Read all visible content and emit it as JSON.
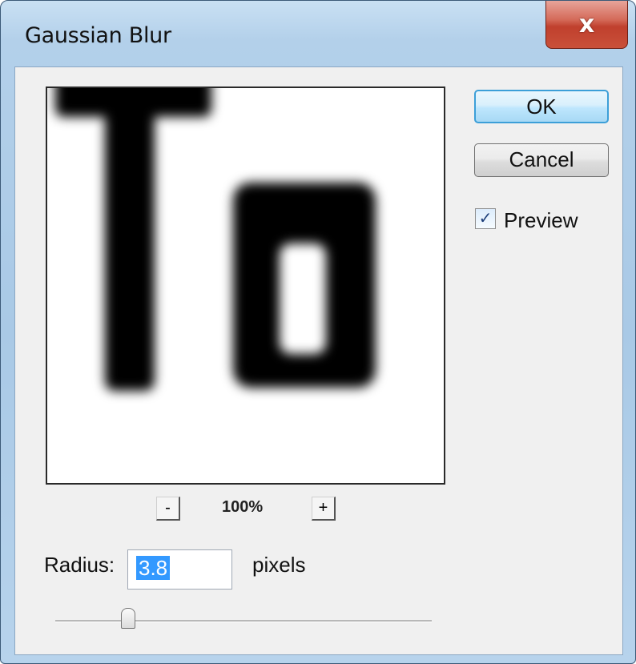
{
  "window": {
    "title": "Gaussian Blur",
    "close_glyph": "x"
  },
  "preview": {
    "sample_text": "To"
  },
  "zoom": {
    "minus_label": "-",
    "level": "100%",
    "plus_label": "+"
  },
  "buttons": {
    "ok_label": "OK",
    "cancel_label": "Cancel"
  },
  "preview_toggle": {
    "label": "Preview",
    "checked": true,
    "check_glyph": "✓"
  },
  "radius": {
    "label": "Radius:",
    "value": "3.8",
    "units": "pixels"
  },
  "slider": {
    "icon": "slider-thumb"
  },
  "colors": {
    "ok_border": "#3c9fd8",
    "selection": "#3399ff",
    "close_red": "#c0402d"
  }
}
